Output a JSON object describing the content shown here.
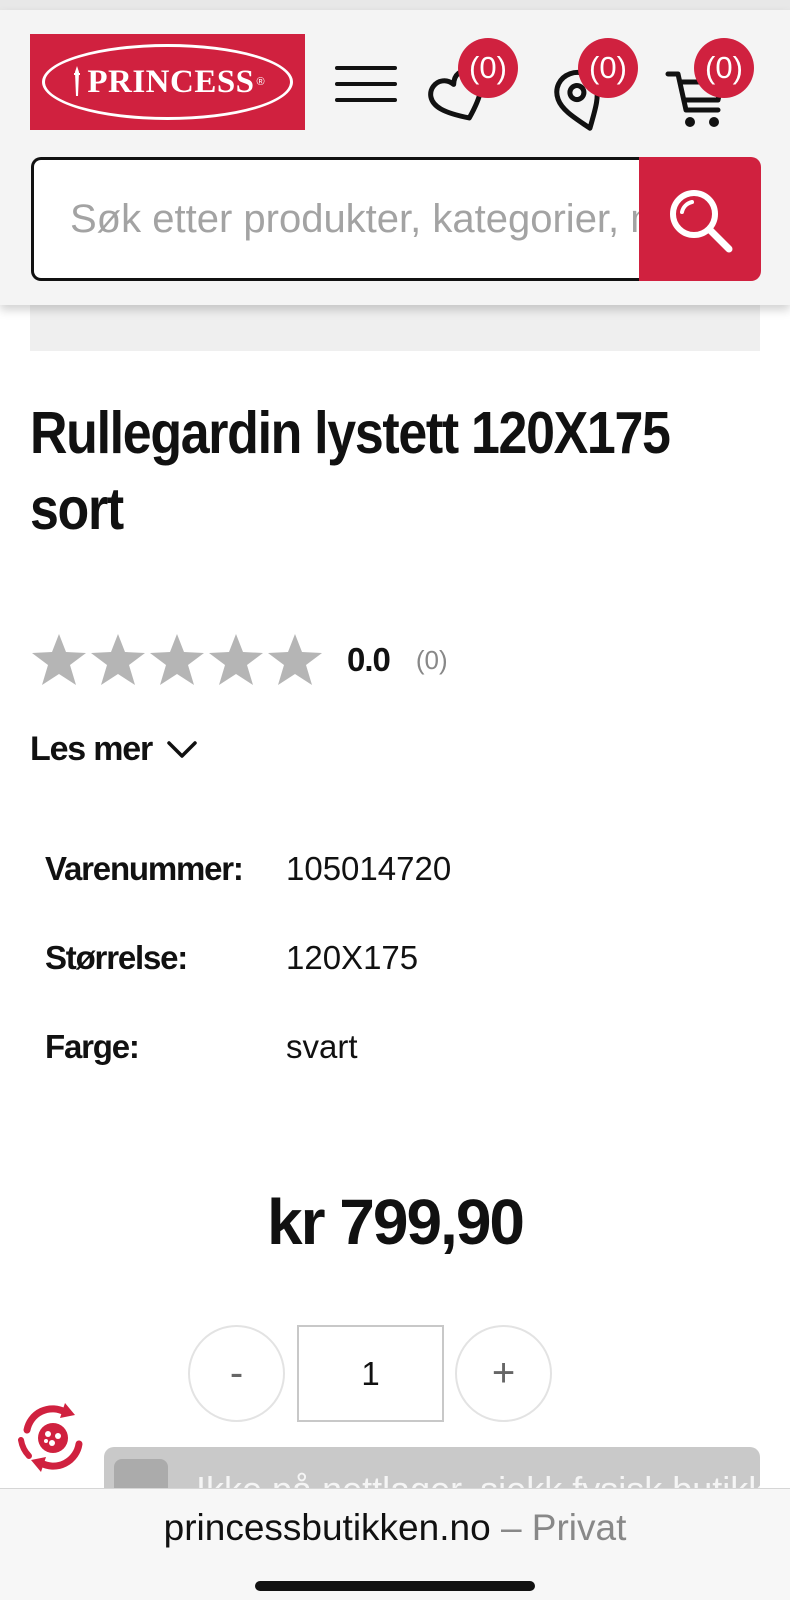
{
  "header": {
    "logo_text": "PRINCESS",
    "logo_reg": "®",
    "wishlist_count": "(0)",
    "stores_count": "(0)",
    "cart_count": "(0)"
  },
  "search": {
    "placeholder": "Søk etter produkter, kategorier, merker"
  },
  "product": {
    "title_line1": "Rullegardin lystett 120X175",
    "title_line2": "sort",
    "rating_value": "0.0",
    "rating_count": "(0)",
    "rating_stars": 0,
    "rating_max": 5,
    "read_more": "Les mer",
    "specs": [
      {
        "label": "Varenummer:",
        "value": "105014720"
      },
      {
        "label": "Størrelse:",
        "value": "120X175"
      },
      {
        "label": "Farge:",
        "value": "svart"
      }
    ],
    "price": "kr 799,90",
    "quantity": "1",
    "qty_minus": "-",
    "qty_plus": "+",
    "stock_button": "Ikke på nettlager, sjekk fysisk butikk"
  },
  "browser": {
    "domain": "princessbutikken.no",
    "separator": "–",
    "mode": "Privat"
  },
  "colors": {
    "brand_red": "#d0213f",
    "star_gray": "#b5b5b5"
  }
}
